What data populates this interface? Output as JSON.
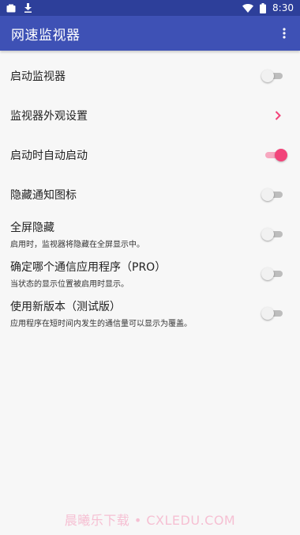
{
  "status_bar": {
    "time": "8:30",
    "left_icons": [
      "notification-box-icon",
      "download-icon"
    ],
    "right_icons": [
      "wifi-icon",
      "battery-icon"
    ]
  },
  "app_bar": {
    "title": "网速监视器",
    "overflow_icon": "more-vert-icon",
    "color": "#3e51b5"
  },
  "settings": [
    {
      "title": "启动监视器",
      "control": "toggle",
      "on": false
    },
    {
      "title": "监视器外观设置",
      "control": "chevron"
    },
    {
      "title": "启动时自动启动",
      "control": "toggle",
      "on": true
    },
    {
      "title": "隐藏通知图标",
      "control": "toggle",
      "on": false
    },
    {
      "title": "全屏隐藏",
      "subtitle": "启用时，监视器将隐藏在全屏显示中。",
      "control": "toggle",
      "on": false
    },
    {
      "title": "确定哪个通信应用程序（PRO）",
      "subtitle": "当状态的显示位置被启用时显示。",
      "control": "toggle",
      "on": false
    },
    {
      "title": "使用新版本（测试版）",
      "subtitle": "应用程序在短时间内发生的通信量可以显示为覆盖。",
      "control": "toggle",
      "on": false
    }
  ],
  "accent_color": "#f2447a",
  "watermark": "晨曦乐下载 • CXLEDU.COM"
}
